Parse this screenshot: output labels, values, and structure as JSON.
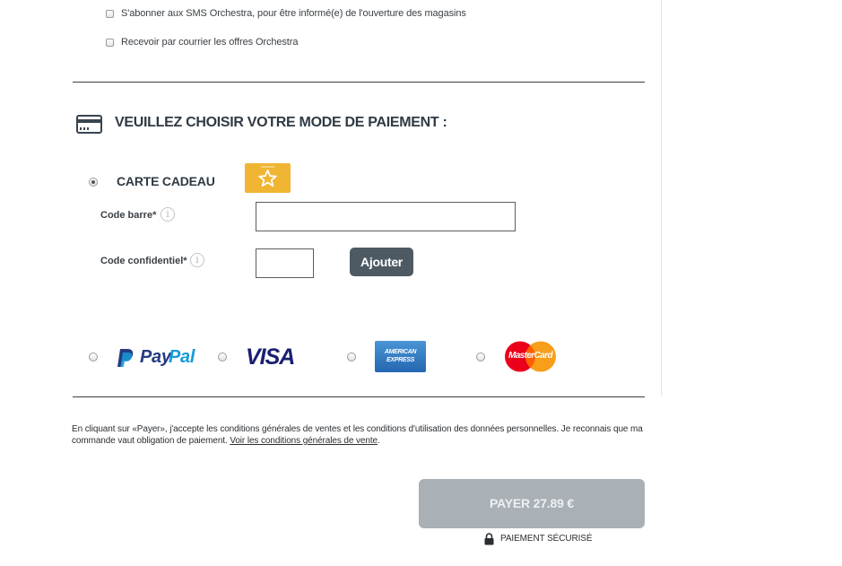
{
  "options": {
    "sms_label": "S'abonner aux SMS Orchestra, pour être informé(e) de l'ouverture des magasins",
    "mail_label": "Recevoir par courrier les offres Orchestra"
  },
  "payment": {
    "title": "VEUILLEZ CHOISIR VOTRE MODE DE PAIEMENT :",
    "gift_card_label": "CARTE CADEAU",
    "barcode_label": "Code barre*",
    "barcode_value": "",
    "code_label": "Code confidentiel*",
    "code_value": "",
    "add_button": "Ajouter",
    "methods": {
      "paypal_pay": "Pay",
      "paypal_pal": "Pal",
      "visa": "VISA",
      "amex_line1": "AMERICAN",
      "amex_line2": "EXPRESS",
      "mastercard": "MasterCard"
    }
  },
  "legal": {
    "text": "En cliquant sur «Payer», j'accepte les conditions générales de ventes et les conditions d'utilisation des données personnelles. Je reconnais que ma commande vaut obligation de paiement. ",
    "link": "Voir les conditions générales de vente",
    "end": "."
  },
  "pay_button": "PAYER 27.89 €",
  "secure_label": "PAIEMENT SÉCURISÉ",
  "colors": {
    "text": "#2b2f33",
    "button_dark": "#4d5a64",
    "pay_disabled": "#a9b0b6",
    "gift_card": "#f0b532",
    "paypal_dark": "#253b80",
    "paypal_light": "#179bd7",
    "visa": "#1a1f71",
    "amex": "#2e77bc",
    "mc_red": "#eb001b",
    "mc_orange": "#f79e1b"
  },
  "icons": [
    "credit-card-icon",
    "gift-card-star-icon",
    "info-icon",
    "lock-icon"
  ]
}
